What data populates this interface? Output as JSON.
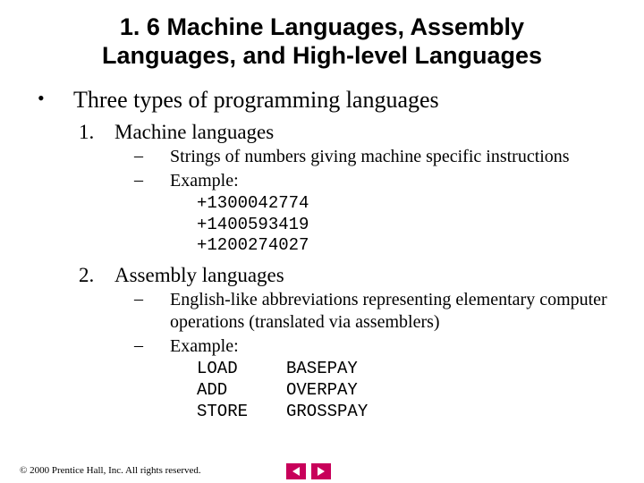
{
  "title": "1. 6 Machine Languages, Assembly Languages, and High-level Languages",
  "bullet": "Three types of programming languages",
  "items": [
    {
      "num": "1.",
      "label": "Machine languages",
      "dash1": "Strings of numbers giving machine specific instructions",
      "dash2": "Example:",
      "code": [
        "+1300042774",
        "+1400593419",
        "+1200274027"
      ]
    },
    {
      "num": "2.",
      "label": "Assembly languages",
      "dash1": "English-like abbreviations representing elementary computer operations (translated via assemblers)",
      "dash2": "Example:",
      "asm": [
        {
          "op": "LOAD",
          "arg": "BASEPAY"
        },
        {
          "op": "ADD",
          "arg": "OVERPAY"
        },
        {
          "op": "STORE",
          "arg": "GROSSPAY"
        }
      ]
    }
  ],
  "footer": "2000 Prentice Hall, Inc. All rights reserved.",
  "copyright_symbol": "©"
}
